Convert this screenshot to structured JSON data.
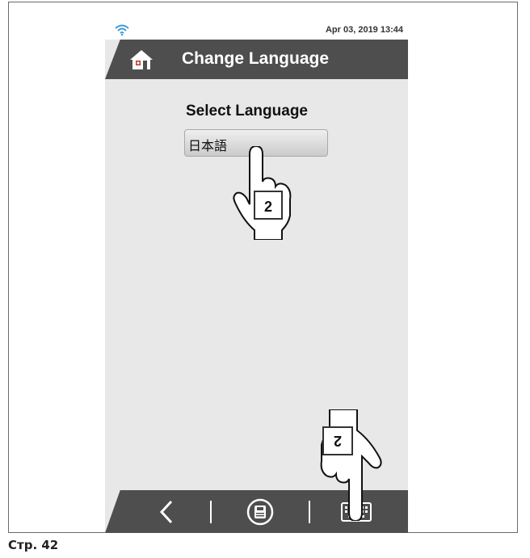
{
  "status_bar": {
    "datetime": "Apr 03, 2019 13:44"
  },
  "header": {
    "title": "Change Language"
  },
  "main": {
    "select_label": "Select Language",
    "selected_language": "日本語"
  },
  "callouts": {
    "step_top": "2",
    "step_bottom": "2"
  },
  "footer": {
    "page_number": "Стр. 42"
  },
  "icons": {
    "status": "wifi-icon",
    "home": "home-icon",
    "back": "chevron-left-icon",
    "save": "save-icon",
    "keyboard": "keyboard-icon"
  },
  "colors": {
    "bar": "#4e4e4e",
    "screen": "#e8e8e8"
  }
}
